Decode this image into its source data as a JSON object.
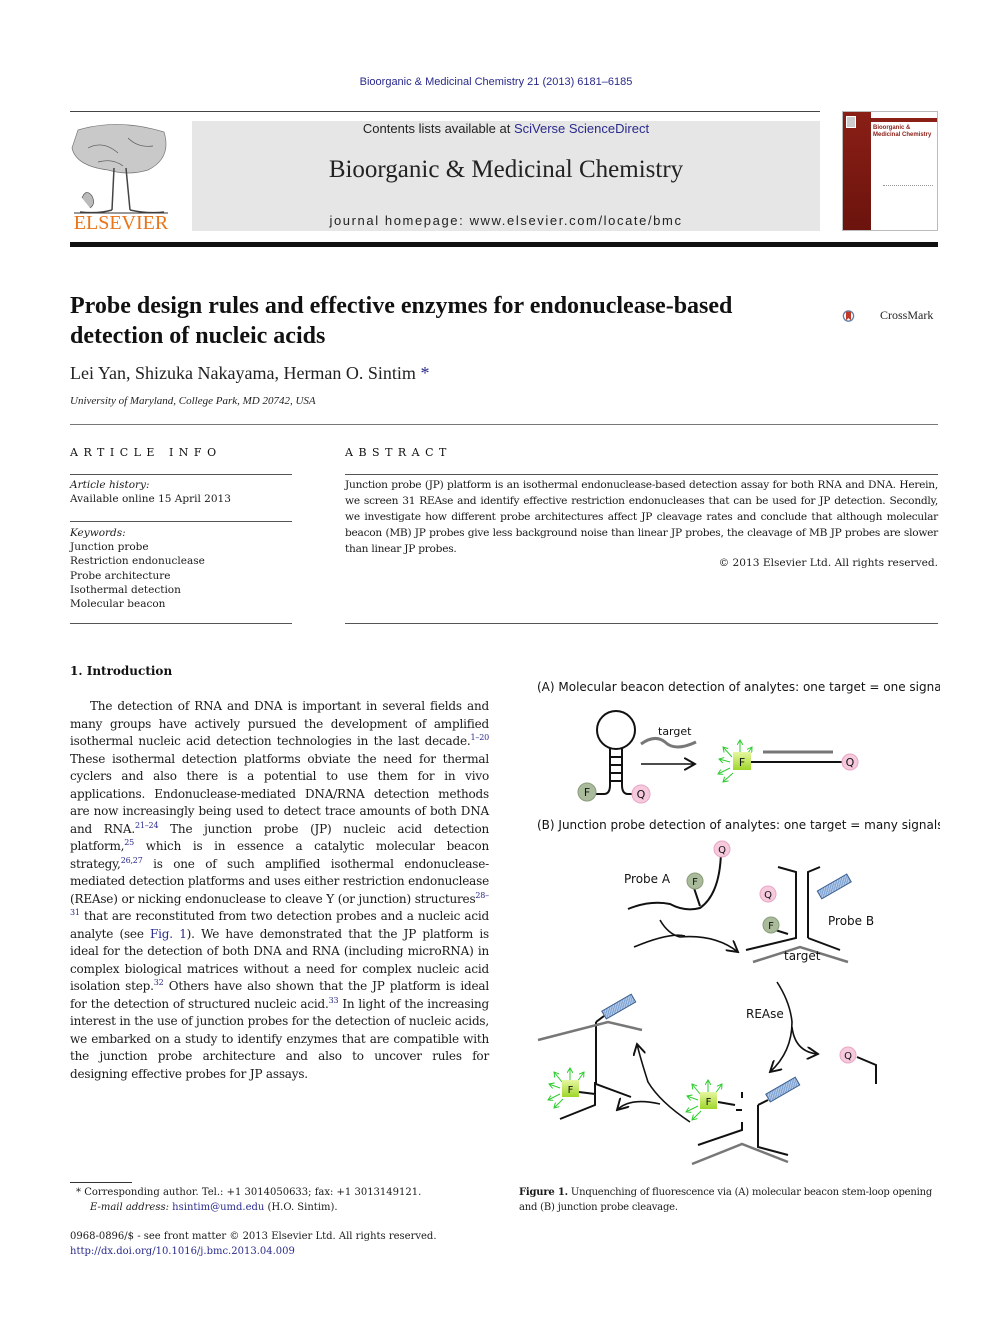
{
  "header": {
    "citation": "Bioorganic & Medicinal Chemistry 21 (2013) 6181–6185",
    "contents_prefix": "Contents lists available at ",
    "contents_link": "SciVerse ScienceDirect",
    "journal_title": "Bioorganic & Medicinal Chemistry",
    "homepage_prefix": "journal homepage: ",
    "homepage_url": "www.elsevier.com/locate/bmc",
    "publisher": "ELSEVIER",
    "cover_title": "Bioorganic & Medicinal Chemistry",
    "crossmark": "CrossMark"
  },
  "article": {
    "title": "Probe design rules and effective enzymes for endonuclease-based detection of nucleic acids",
    "authors": "Lei Yan, Shizuka Nakayama, Herman O. Sintim",
    "corresponding_mark": "*",
    "affiliation": "University of Maryland, College Park, MD 20742, USA"
  },
  "article_info": {
    "heading": "ARTICLE INFO",
    "history_label": "Article history:",
    "history_value": "Available online 15 April 2013",
    "keywords_label": "Keywords:",
    "keywords": [
      "Junction probe",
      "Restriction endonuclease",
      "Probe architecture",
      "Isothermal detection",
      "Molecular beacon"
    ]
  },
  "abstract": {
    "heading": "ABSTRACT",
    "text": "Junction probe (JP) platform is an isothermal endonuclease-based detection assay for both RNA and DNA. Herein, we screen 31 REAse and identify effective restriction endonucleases that can be used for JP detection. Secondly, we investigate how different probe architectures affect JP cleavage rates and conclude that although molecular beacon (MB) JP probes give less background noise than linear JP probes, the cleavage of MB JP probes are slower than linear JP probes.",
    "copyright": "© 2013 Elsevier Ltd. All rights reserved."
  },
  "introduction": {
    "heading": "1. Introduction",
    "segments": [
      {
        "text": "The detection of RNA and DNA is important in several fields and many groups have actively pursued the development of amplified isothermal nucleic acid detection technologies in the last decade."
      },
      {
        "ref": "1–20"
      },
      {
        "text": " These isothermal detection platforms obviate the need for thermal cyclers and also there is a potential to use them for in vivo applications. Endonuclease-mediated DNA/RNA detection methods are now increasingly being used to detect trace amounts of both DNA and RNA."
      },
      {
        "ref": "21–24"
      },
      {
        "text": " The junction probe (JP) nucleic acid detection platform,"
      },
      {
        "ref": "25"
      },
      {
        "text": " which is in essence a catalytic molecular beacon strategy,"
      },
      {
        "ref": "26,27"
      },
      {
        "text": " is one of such amplified isothermal endonuclease-mediated detection platforms and uses either restriction endonuclease (REAse) or nicking endonuclease to cleave Y (or junction) structures"
      },
      {
        "ref": "28–31"
      },
      {
        "text": " that are reconstituted from two detection probes and a nucleic acid analyte (see "
      },
      {
        "link": "Fig. 1"
      },
      {
        "text": "). We have demonstrated that the JP platform is ideal for the detection of both DNA and RNA (including microRNA) in complex biological matrices without a need for complex nucleic acid isolation step."
      },
      {
        "ref": "32"
      },
      {
        "text": " Others have also shown that the JP platform is ideal for the detection of structured nucleic acid."
      },
      {
        "ref": "33"
      },
      {
        "text": " In light of the increasing interest in the use of junction probes for the detection of nucleic acids, we embarked on a study to identify enzymes that are compatible with the junction probe architecture and also to uncover rules for designing effective probes for JP assays."
      }
    ]
  },
  "figure": {
    "panel_a_title": "(A) Molecular beacon detection of analytes: one target = one signal",
    "panel_b_title": "(B) Junction probe detection of analytes: one target = many signals",
    "label_target": "target",
    "label_probe_a": "Probe A",
    "label_probe_b": "Probe B",
    "label_rease": "REAse",
    "label_f": "F",
    "label_q": "Q",
    "caption_label": "Figure 1.",
    "caption_text": " Unquenching of fluorescence via (A) molecular beacon stem-loop opening and (B) junction probe cleavage.",
    "colors": {
      "fluor_bead": "#a9bb9b",
      "quencher": "#f6c9dd",
      "fluor_on": "#b8e23a",
      "rays": "#2ecc2e",
      "probe_tag": "#6f95c9",
      "target": "#777777"
    }
  },
  "footnotes": {
    "corresponding": "Corresponding author. Tel.: +1 3014050633; fax: +1 3013149121.",
    "email_label": "E-mail address: ",
    "email": "hsintim@umd.edu",
    "email_suffix": " (H.O. Sintim).",
    "issn": "0968-0896/$ - see front matter © 2013 Elsevier Ltd. All rights reserved.",
    "doi": "http://dx.doi.org/10.1016/j.bmc.2013.04.009"
  }
}
